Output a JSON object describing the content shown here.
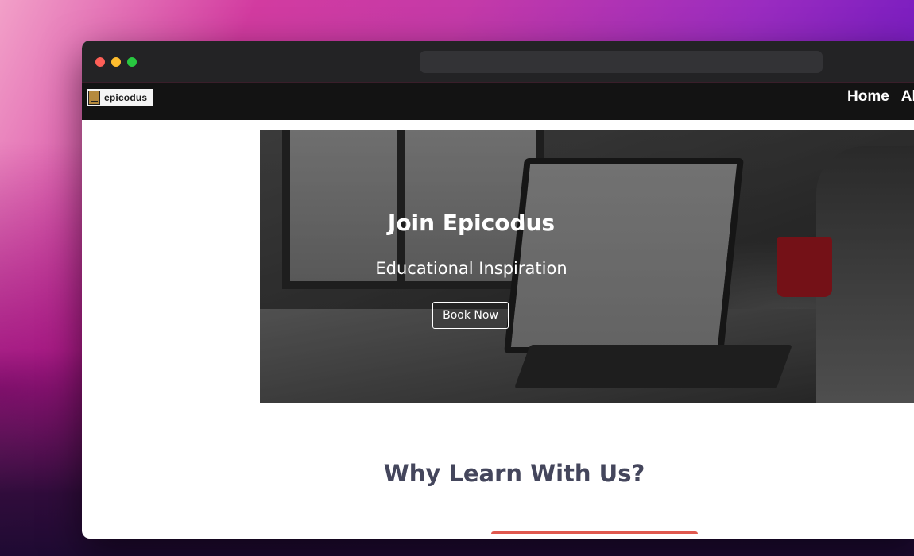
{
  "navbar": {
    "logo_text": "epicodus",
    "links": [
      "Home",
      "Al"
    ]
  },
  "hero": {
    "title": "Join Epicodus",
    "subtitle": "Educational Inspiration",
    "button_label": "Book Now"
  },
  "section": {
    "title": "Why Learn With Us?"
  },
  "colors": {
    "section_title": "#44465c",
    "accent": "#e0584f"
  }
}
